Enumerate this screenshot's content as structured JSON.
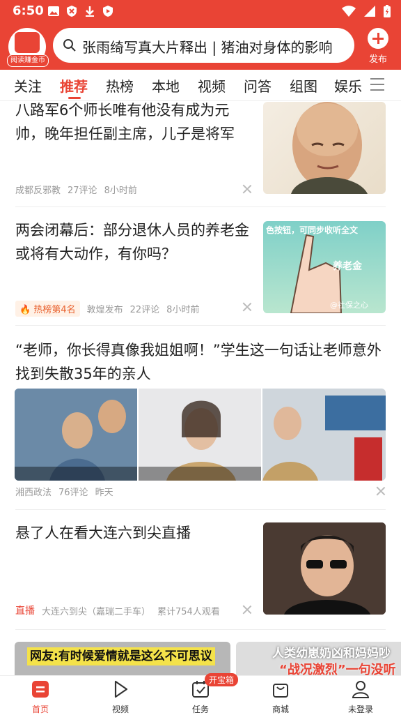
{
  "status_bar": {
    "time": "6:50"
  },
  "header": {
    "avatar_badge": "阅读赚金币",
    "search_text": "张雨绮写真大片释出 | 猪油对身体的影响",
    "publish_label": "发布"
  },
  "tabs": [
    "关注",
    "推荐",
    "热榜",
    "本地",
    "视频",
    "问答",
    "组图",
    "娱乐"
  ],
  "feed": [
    {
      "title": "八路军6个师长唯有他没有成为元帅，晚年担任副主席，儿子是将军",
      "source": "成都反邪教",
      "comments": "27评论",
      "time": "8小时前"
    },
    {
      "title": "两会闭幕后：部分退休人员的养老金或将有大动作，有你吗？",
      "hot": "热榜第4名",
      "source": "敦煌发布",
      "comments": "22评论",
      "time": "8小时前",
      "thumb_text": "养老金",
      "thumb_top": "色按钮，可同步收听全文",
      "thumb_watermark": "@社保之心"
    },
    {
      "title": "“老师，你长得真像我姐姐啊！”学生这一句话让老师意外找到失散35年的亲人",
      "source": "湘西政法",
      "comments": "76评论",
      "time": "昨天"
    },
    {
      "title": "悬了人在看大连六到尖直播",
      "live": "直播",
      "source": "大连六到尖（嘉瑞二手车）",
      "viewers": "累计754人观看"
    },
    {
      "banner_left": "网友:有时候爱情就是这么不可思议",
      "banner_right_1": "人类幼崽奶凶和妈妈吵",
      "banner_right_2": "“战况激烈”一句没听"
    }
  ],
  "bottom_nav": [
    {
      "label": "首页"
    },
    {
      "label": "视频"
    },
    {
      "label": "任务",
      "badge": "开宝箱"
    },
    {
      "label": "商城"
    },
    {
      "label": "未登录"
    }
  ]
}
